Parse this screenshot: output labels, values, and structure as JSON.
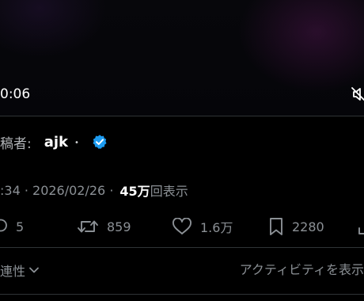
{
  "video": {
    "elapsed_time": "0:06",
    "mute_icon": "speaker-muted-icon"
  },
  "poster": {
    "label": "稿者:",
    "name": "ajk",
    "dot": "•",
    "badge_icon": "verified-badge-icon",
    "badge_color": "#1d9bf0"
  },
  "meta": {
    "time_date": ":34 · 2026/02/26 ·",
    "views_count": "45万",
    "views_label": "回表示"
  },
  "actions": {
    "reply_count": "5",
    "repost_count": "859",
    "like_count": "1.6万",
    "bookmark_count": "2280"
  },
  "footer": {
    "related_label": "連性",
    "activity_label": "アクティビティを表示"
  },
  "colors": {
    "background": "#000000",
    "muted_text": "#8b9095",
    "primary_text": "#ffffff",
    "divider": "#2f3336"
  }
}
